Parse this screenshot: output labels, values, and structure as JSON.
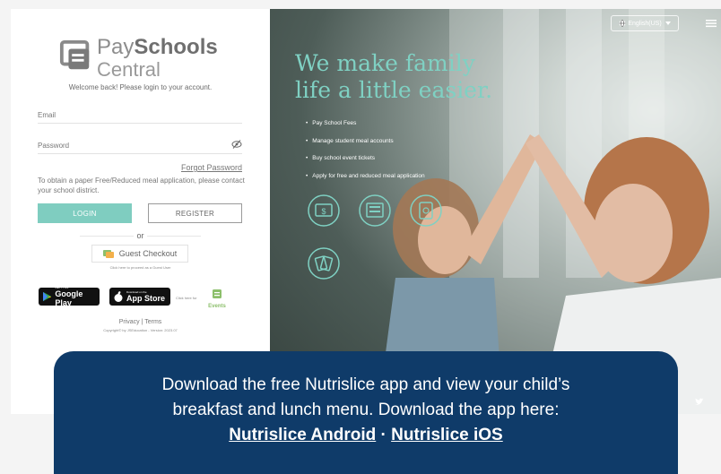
{
  "login": {
    "logo_pay": "Pay",
    "logo_schools": "Schools",
    "logo_central": "Central",
    "welcome": "Welcome back! Please login to your account.",
    "email_label": "Email",
    "password_label": "Password",
    "forgot": "Forgot Password",
    "notice": "To obtain a paper Free/Reduced meal application, please contact your school district.",
    "login_button": "LOGIN",
    "register_button": "REGISTER",
    "or": "or",
    "guest_button": "Guest Checkout",
    "guest_hint": "Click here to proceed as a Guest User",
    "google_small": "GET IT ON",
    "google_big": "Google Play",
    "apple_small": "Download on the",
    "apple_big": "App Store",
    "events_hint": "Click here for",
    "events_word": "Events",
    "privacy": "Privacy",
    "separator": "|",
    "terms": "Terms",
    "copyright": "Copyright© by JSEducation - Version: 2023.07"
  },
  "hero": {
    "language": "English(US)",
    "tagline_line1": "We make family",
    "tagline_line2": "life a little easier.",
    "features": [
      "Pay School Fees",
      "Manage student meal accounts",
      "Buy school event tickets",
      "Apply for free and reduced meal application"
    ],
    "icons": [
      "payment-icon",
      "meal-account-icon",
      "ticket-icon",
      "application-icon"
    ]
  },
  "banner": {
    "line1": "Download the free Nutrislice app and view your child’s",
    "line2": "breakfast and lunch menu. Download the app here:",
    "android_link": "Nutrislice Android",
    "dot": "·",
    "ios_link": "Nutrislice iOS"
  },
  "colors": {
    "accent": "#7fcdc0",
    "banner": "#0f3b69",
    "tagline": "#7fd1c3"
  }
}
